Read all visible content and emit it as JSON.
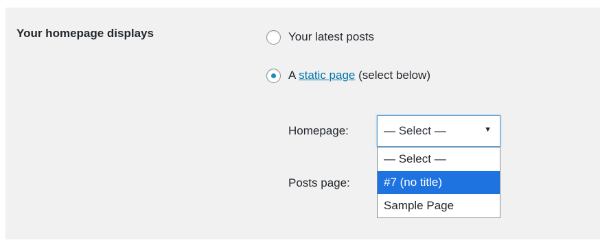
{
  "setting": {
    "label": "Your homepage displays"
  },
  "radios": {
    "latest_posts": {
      "label": "Your latest posts",
      "checked": false
    },
    "static_page": {
      "prefix": "A",
      "link_text": "static page",
      "suffix": "(select below)",
      "checked": true
    }
  },
  "homepage_field": {
    "label": "Homepage:",
    "selected_value": "— Select —",
    "options": [
      "— Select —",
      "#7 (no title)",
      "Sample Page"
    ],
    "highlighted_index": 1
  },
  "posts_page_field": {
    "label": "Posts page:"
  },
  "colors": {
    "panel_bg": "#f1f1f1",
    "link": "#0073aa",
    "radio_dot": "#1e8cbe",
    "highlight": "#1e73e0"
  },
  "icons": {
    "select_arrow": "triangle-down-icon"
  }
}
